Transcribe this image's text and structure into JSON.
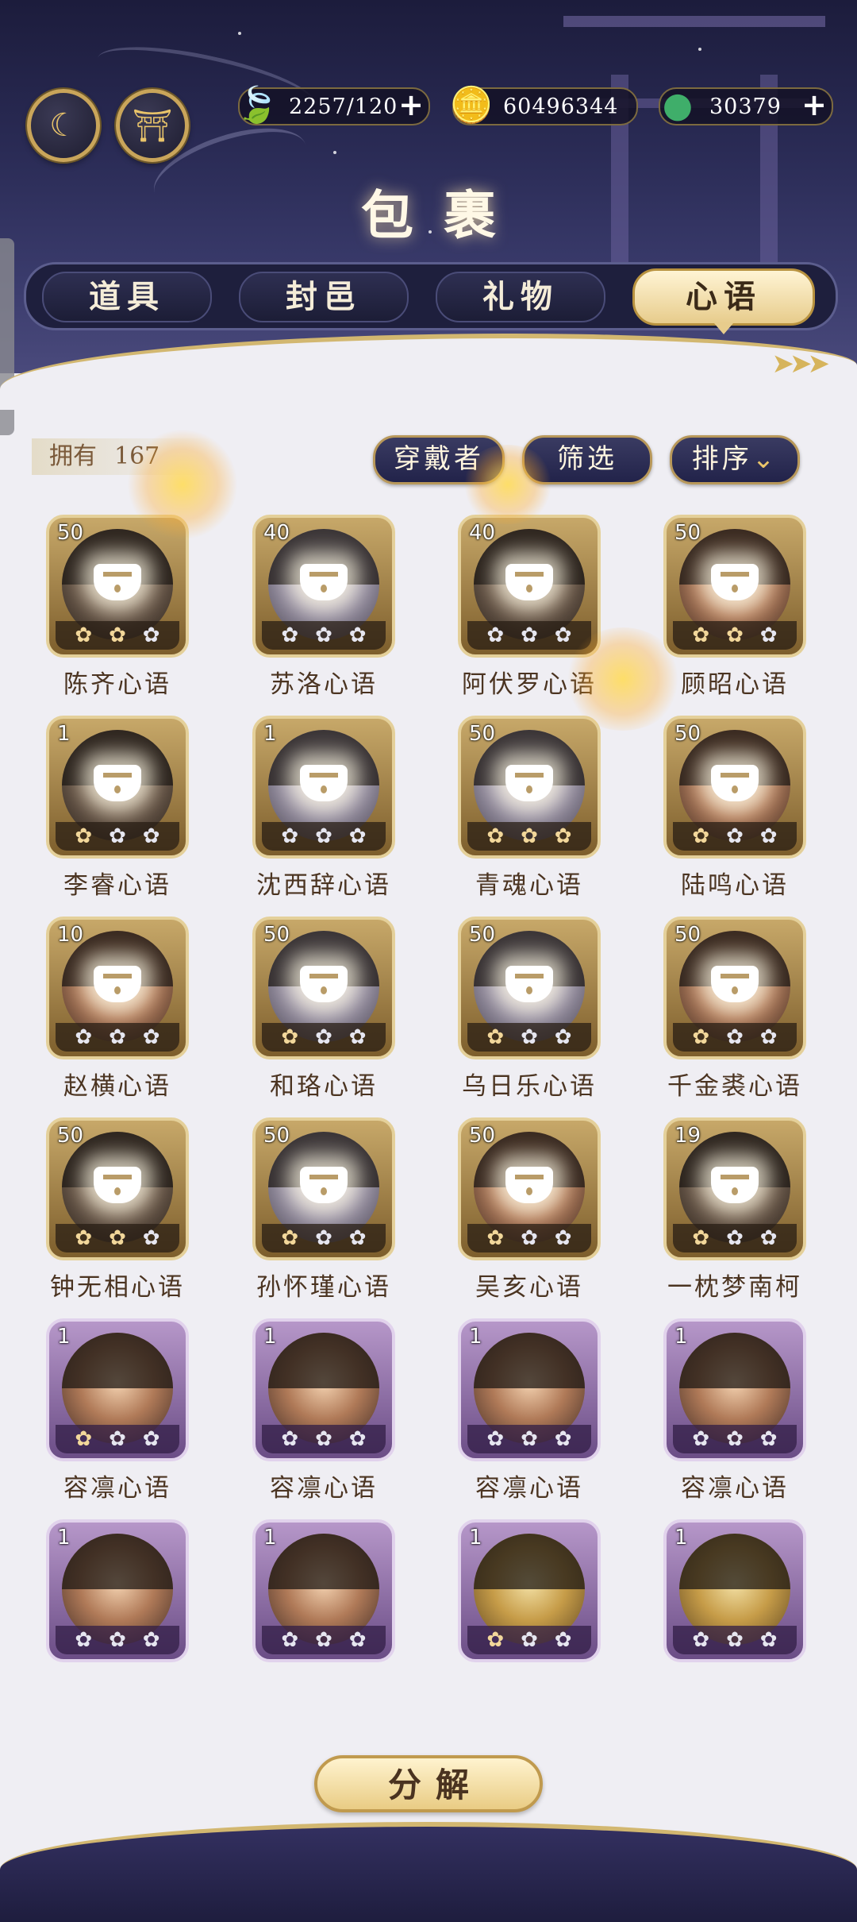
{
  "title": "包裹",
  "header": {
    "left_buttons": [
      {
        "name": "back-moon-icon",
        "glyph": "☾"
      },
      {
        "name": "pavilion-icon",
        "glyph": "⛩"
      }
    ],
    "currencies": [
      {
        "name": "leaf-currency",
        "icon": "🍃",
        "value": "2257/120",
        "has_plus": true
      },
      {
        "name": "coin-currency",
        "icon": "🪙",
        "value": "60496344",
        "has_plus": false
      },
      {
        "name": "jade-currency",
        "icon": "●",
        "value": "30379",
        "has_plus": true
      }
    ],
    "plus": "+"
  },
  "tabs": [
    {
      "label": "道具",
      "active": false
    },
    {
      "label": "封邑",
      "active": false
    },
    {
      "label": "礼物",
      "active": false
    },
    {
      "label": "心语",
      "active": true
    }
  ],
  "arrows": "➤➤➤",
  "toolbar": {
    "owned_label": "拥有",
    "owned_count": "167",
    "wearer_label": "穿戴者",
    "filter_label": "筛选",
    "sort_label": "排序",
    "sort_icon": "⌄"
  },
  "items": [
    {
      "level": "50",
      "name": "陈齐心语",
      "frame": "gold",
      "stars_on": 2,
      "locked": true
    },
    {
      "level": "40",
      "name": "苏洛心语",
      "frame": "gold",
      "stars_on": 0,
      "locked": true
    },
    {
      "level": "40",
      "name": "阿伏罗心语",
      "frame": "gold",
      "stars_on": 0,
      "locked": true
    },
    {
      "level": "50",
      "name": "顾昭心语",
      "frame": "gold",
      "stars_on": 2,
      "locked": true
    },
    {
      "level": "1",
      "name": "李睿心语",
      "frame": "gold",
      "stars_on": 1,
      "locked": true
    },
    {
      "level": "1",
      "name": "沈西辞心语",
      "frame": "gold",
      "stars_on": 0,
      "locked": true
    },
    {
      "level": "50",
      "name": "青魂心语",
      "frame": "gold",
      "stars_on": 3,
      "locked": true
    },
    {
      "level": "50",
      "name": "陆鸣心语",
      "frame": "gold",
      "stars_on": 1,
      "locked": true
    },
    {
      "level": "10",
      "name": "赵横心语",
      "frame": "gold",
      "stars_on": 0,
      "locked": true
    },
    {
      "level": "50",
      "name": "和珞心语",
      "frame": "gold",
      "stars_on": 1,
      "locked": true
    },
    {
      "level": "50",
      "name": "乌日乐心语",
      "frame": "gold",
      "stars_on": 1,
      "locked": true
    },
    {
      "level": "50",
      "name": "千金裘心语",
      "frame": "gold",
      "stars_on": 1,
      "locked": true
    },
    {
      "level": "50",
      "name": "钟无相心语",
      "frame": "gold",
      "stars_on": 2,
      "locked": true
    },
    {
      "level": "50",
      "name": "孙怀瑾心语",
      "frame": "gold",
      "stars_on": 1,
      "locked": true
    },
    {
      "level": "50",
      "name": "吴亥心语",
      "frame": "gold",
      "stars_on": 1,
      "locked": true
    },
    {
      "level": "19",
      "name": "一枕梦南柯",
      "frame": "gold",
      "stars_on": 1,
      "locked": true
    },
    {
      "level": "1",
      "name": "容凛心语",
      "frame": "purple",
      "stars_on": 1,
      "locked": false
    },
    {
      "level": "1",
      "name": "容凛心语",
      "frame": "purple",
      "stars_on": 0,
      "locked": false
    },
    {
      "level": "1",
      "name": "容凛心语",
      "frame": "purple",
      "stars_on": 0,
      "locked": false
    },
    {
      "level": "1",
      "name": "容凛心语",
      "frame": "purple",
      "stars_on": 0,
      "locked": false
    },
    {
      "level": "1",
      "name": "",
      "frame": "purple",
      "stars_on": 0,
      "locked": false
    },
    {
      "level": "1",
      "name": "",
      "frame": "purple",
      "stars_on": 0,
      "locked": false
    },
    {
      "level": "1",
      "name": "",
      "frame": "purple",
      "stars_on": 1,
      "locked": false
    },
    {
      "level": "1",
      "name": "",
      "frame": "purple",
      "stars_on": 0,
      "locked": false
    }
  ],
  "petal_glyph": "✿",
  "decompose_label": "分解",
  "colors": {
    "gold": "#c9a55a",
    "navy": "#2a2b55",
    "text_brown": "#4b3421"
  }
}
